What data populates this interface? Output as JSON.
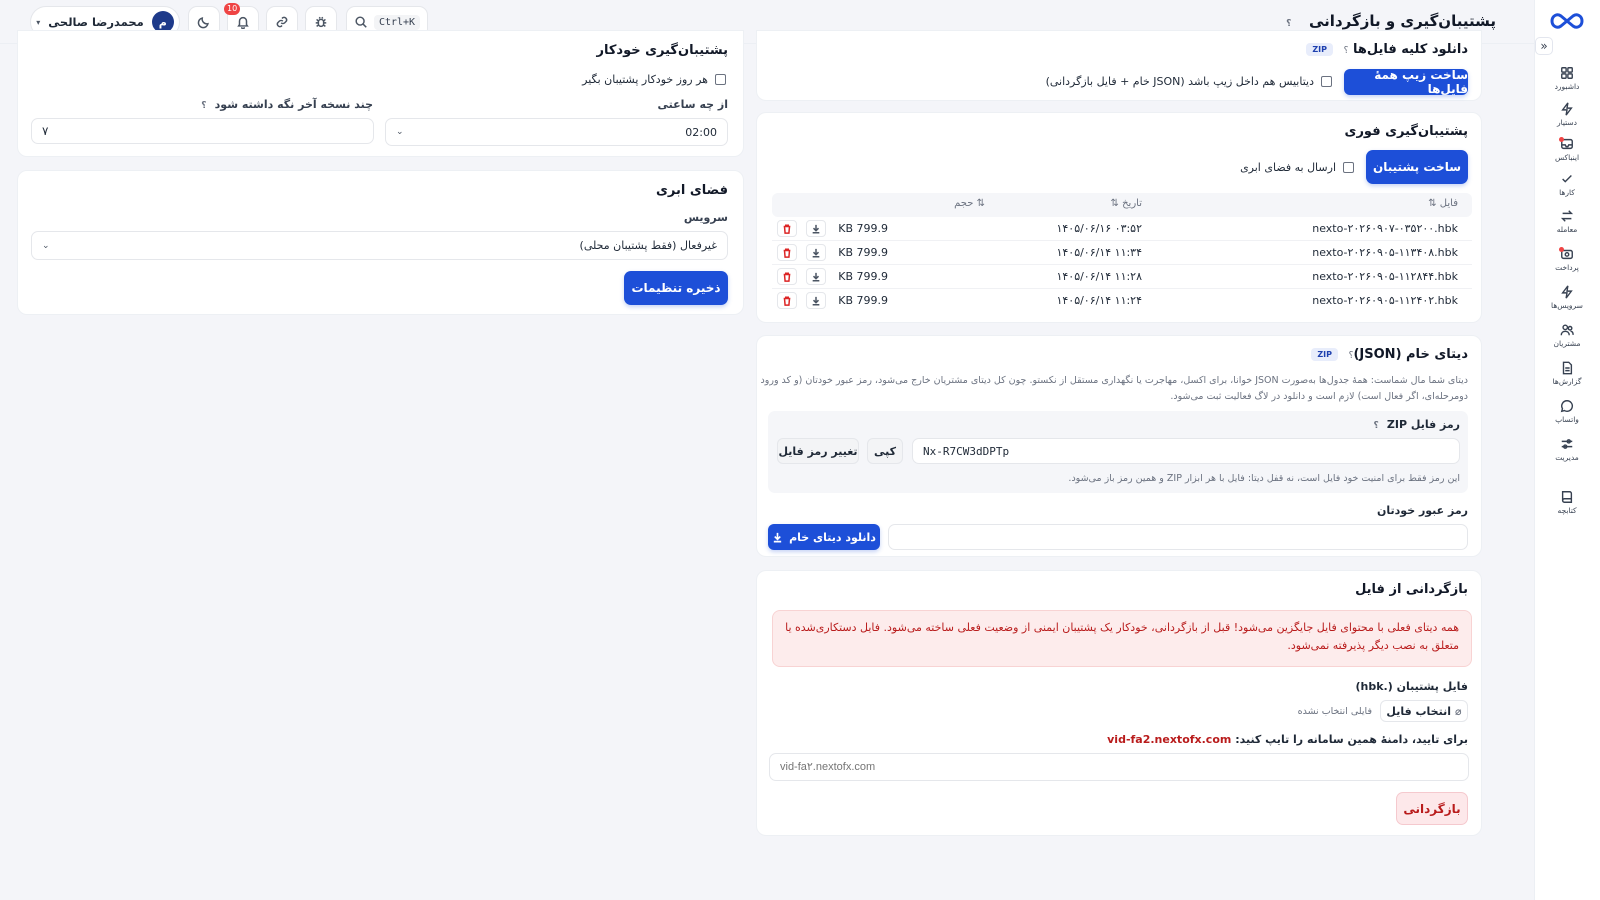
{
  "app": {
    "page_title": "پشتیبان‌گیری و بازگردانی",
    "help_mark": "؟",
    "brand_color": "#1d4fd8",
    "danger_color": "#b91c1c"
  },
  "header": {
    "user_name": "محمدرضا صالحی",
    "user_initial": "م",
    "search_shortcut": "Ctrl+K",
    "notifications_count": "10",
    "icons": [
      "moon-icon",
      "bell-icon",
      "link-icon",
      "bug-icon",
      "search-icon"
    ]
  },
  "sidebar": {
    "collapse_glyph": "«",
    "items": [
      {
        "label": "داشبورد",
        "icon": "dashboard-icon"
      },
      {
        "label": "دستیار",
        "icon": "bolt-icon"
      },
      {
        "label": "اینباکس",
        "icon": "inbox-icon",
        "dot": true
      },
      {
        "label": "کارها",
        "icon": "check-icon"
      },
      {
        "label": "معامله",
        "icon": "swap-icon"
      },
      {
        "label": "پرداخت",
        "icon": "payment-icon",
        "dot": true
      },
      {
        "label": "سرویس‌ها",
        "icon": "bolt-icon"
      },
      {
        "label": "مشتریان",
        "icon": "users-icon"
      },
      {
        "label": "گزارش‌ها",
        "icon": "report-icon"
      },
      {
        "label": "واتساپ",
        "icon": "chat-icon"
      },
      {
        "label": "مدیریت",
        "icon": "sliders-icon"
      },
      {
        "label": "کتابچه",
        "icon": "book-icon"
      }
    ]
  },
  "download_all": {
    "title": "دانلود کلیه فایل‌ها",
    "badge": "ZIP",
    "button": "ساخت زیپ همهٔ فایل‌ها",
    "checkbox_label": "دیتابیس هم داخل زیپ باشد (JSON خام + فایل بازگردانی)"
  },
  "instant_backup": {
    "title": "پشتیبان‌گیری فوری",
    "button": "ساخت پشتیبان",
    "cloud_checkbox": "ارسال به فضای ابری",
    "columns": {
      "file": "فایل ⇅",
      "date": "تاریخ ⇅",
      "size": "⇅ حجم"
    },
    "rows": [
      {
        "file": "nexto-۲۰۲۶۰۹۰۷-۰۳۵۲۰۰.hbk",
        "date": "۰۳:۵۲ ۱۴۰۵/۰۶/۱۶",
        "size": "799.9 KB"
      },
      {
        "file": "nexto-۲۰۲۶۰۹۰۵-۱۱۳۴۰۸.hbk",
        "date": "۱۱:۳۴ ۱۴۰۵/۰۶/۱۴",
        "size": "799.9 KB"
      },
      {
        "file": "nexto-۲۰۲۶۰۹۰۵-۱۱۲۸۴۴.hbk",
        "date": "۱۱:۲۸ ۱۴۰۵/۰۶/۱۴",
        "size": "799.9 KB"
      },
      {
        "file": "nexto-۲۰۲۶۰۹۰۵-۱۱۲۴۰۲.hbk",
        "date": "۱۱:۲۴ ۱۴۰۵/۰۶/۱۴",
        "size": "799.9 KB"
      }
    ]
  },
  "raw_data": {
    "title": "دیتای خام (JSON)",
    "badge": "ZIP",
    "desc_1": "دیتای شما مال شماست: همهٔ جدول‌ها به‌صورت JSON خوانا، برای اکسل، مهاجرت یا نگهداری مستقل از نکستو. چون کل دیتای مشتریان خارج می‌شود، رمز عبور خودتان (و کد ورود",
    "desc_2": "دومرحله‌ای، اگر فعال است) لازم است و دانلود در لاگ فعالیت ثبت می‌شود.",
    "zip_password_label": "رمز فایل ZIP",
    "zip_password_value": "Nx-R7CW3dDPTp",
    "copy_button": "کپی",
    "change_button": "تغییر رمز فایل",
    "zip_note": "این رمز فقط برای امنیت خود فایل است، نه قفل دیتا: فایل با هر ابزار ZIP و همین رمز باز می‌شود.",
    "your_password_label": "رمز عبور خودتان",
    "your_password_value": "",
    "download_button": "دانلود دیتای خام"
  },
  "restore": {
    "title": "بازگردانی از فایل",
    "alert_1": "همه دیتای فعلی با محتوای فایل جایگزین می‌شود! قبل از بازگردانی، خودکار یک پشتیبان ایمنی از وضعیت فعلی ساخته می‌شود. فایل دستکاری‌شده یا",
    "alert_2": "متعلق به نصب دیگر پذیرفته نمی‌شود.",
    "file_label": "فایل پشتیبان (.hbk)",
    "choose_button": "انتخاب فایل",
    "no_file": "فایلی انتخاب نشده",
    "confirm_label": "برای تایید، دامنهٔ همین سامانه را تایپ کنید:",
    "confirm_domain": "vid-fa2.nextofx.com",
    "confirm_placeholder": "vid-fa۲.nextofx.com",
    "restore_button": "بازگردانی"
  },
  "auto_backup": {
    "title": "پشتیبان‌گیری خودکار",
    "daily_checkbox": "هر روز خودکار پشتیبان بگیر",
    "time_label": "از چه ساعتی",
    "time_value": "02:00",
    "keep_label": "چند نسخه آخر نگه داشته شود",
    "keep_value": "۷"
  },
  "cloud": {
    "title": "فضای ابری",
    "service_label": "سرویس",
    "service_value": "غیرفعال (فقط پشتیبان محلی)",
    "save_button": "ذخیره تنظیمات"
  }
}
